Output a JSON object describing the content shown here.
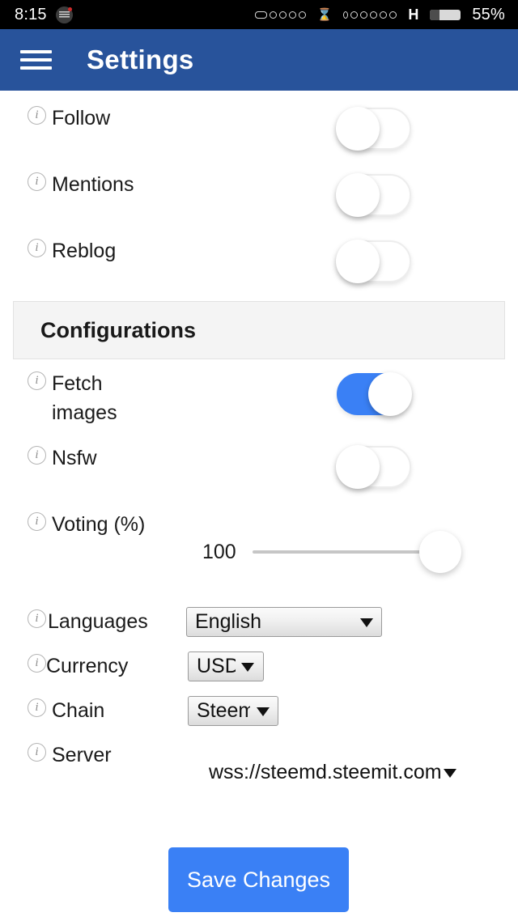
{
  "status_bar": {
    "time": "8:15",
    "app_logo_icon": "blackberry-logo-icon",
    "signal_icon": "signal-bars-icon",
    "hourglass_icon": "hourglass-icon",
    "hourglass_glyph": "⌛",
    "second_signal_icon": "signal-bars-icon",
    "network_type": "H",
    "battery_icon": "battery-icon",
    "battery_percent": "55%"
  },
  "app_bar": {
    "menu_icon": "hamburger-menu-icon",
    "title": "Settings"
  },
  "notifications": {
    "rows": [
      {
        "label": "Follow",
        "info_icon": "info-icon",
        "state": "off"
      },
      {
        "label": "Mentions",
        "info_icon": "info-icon",
        "state": "off"
      },
      {
        "label": "Reblog",
        "info_icon": "info-icon",
        "state": "off"
      }
    ]
  },
  "configurations": {
    "section_title": "Configurations",
    "fetch_images": {
      "label": "Fetch images",
      "info_icon": "info-icon",
      "state": "on"
    },
    "nsfw": {
      "label": "Nsfw",
      "info_icon": "info-icon",
      "state": "off"
    },
    "voting": {
      "label": "Voting (%)",
      "info_icon": "info-icon",
      "value": "100",
      "min": 0,
      "max": 100
    },
    "languages": {
      "label": "Languages",
      "info_icon": "info-icon",
      "selected": "English",
      "options": [
        "English"
      ]
    },
    "currency": {
      "label": "Currency",
      "info_icon": "info-icon",
      "selected": "USD",
      "options": [
        "USD"
      ]
    },
    "chain": {
      "label": "Chain",
      "info_icon": "info-icon",
      "selected": "Steem",
      "options": [
        "Steem"
      ]
    },
    "server": {
      "label": "Server",
      "info_icon": "info-icon",
      "selected": "wss://steemd.steemit.com",
      "options": [
        "wss://steemd.steemit.com"
      ]
    }
  },
  "actions": {
    "save_label": "Save Changes"
  },
  "colors": {
    "app_bar": "#28539b",
    "accent_blue": "#3a80f5",
    "panel_bg": "#f4f4f4",
    "status_bar_bg": "#000000"
  }
}
